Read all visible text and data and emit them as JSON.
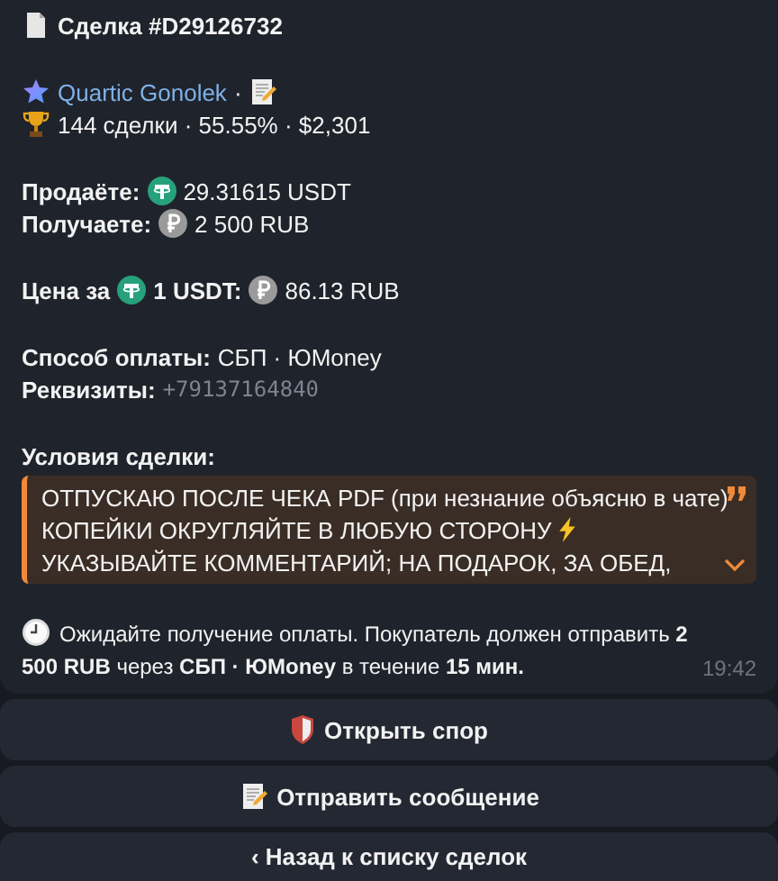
{
  "message": {
    "title": "Сделка #D29126732",
    "seller": {
      "name": "Quartic Gonolek",
      "separator": "·"
    },
    "stats": "144 сделки · 55.55% · $2,301",
    "sell": {
      "label": "Продаёте:",
      "value": "29.31615 USDT"
    },
    "receive": {
      "label": "Получаете:",
      "value": "2 500 RUB"
    },
    "price": {
      "label": "Цена за",
      "unit": "1 USDT:",
      "value": "86.13 RUB"
    },
    "payment_method": {
      "label": "Способ оплаты:",
      "value": "СБП · ЮMoney"
    },
    "requisites": {
      "label": "Реквизиты:",
      "value": "+79137164840"
    },
    "terms": {
      "label": "Условия сделки:",
      "expanded": false,
      "lines": [
        "ОТПУСКАЮ ПОСЛЕ ЧЕКА PDF (при незнание объясню в чате)",
        "КОПЕЙКИ ОКРУГЛЯЙТЕ В ЛЮБУЮ СТОРОНУ",
        "УКАЗЫВАЙТЕ КОММЕНТАРИЙ; НА ПОДАРОК, ЗА ОБЕД,"
      ]
    },
    "status": "Ожидайте получение оплаты. Покупатель должен отправить **2 500 RUB** через **СБП · ЮMoney** в течение **15 мин.**",
    "time": "19:42"
  },
  "buttons": [
    {
      "kind": "dispute",
      "label": "Открыть спор"
    },
    {
      "kind": "message",
      "label": "Отправить сообщение"
    },
    {
      "kind": "back",
      "label": "‹ Назад к списку сделок"
    }
  ]
}
